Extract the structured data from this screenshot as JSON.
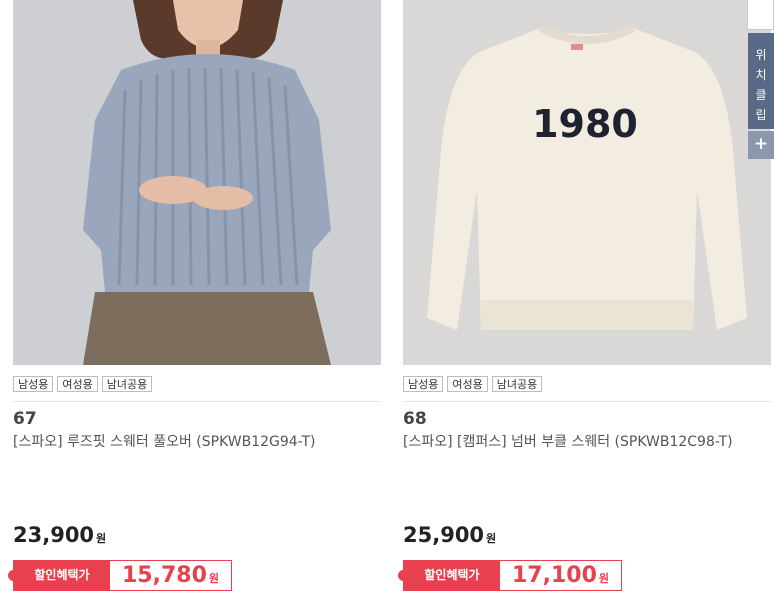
{
  "products": [
    {
      "tags": [
        "남성용",
        "여성용",
        "남녀공용"
      ],
      "rank": "67",
      "name": "[스파오] 루즈핏 스웨터 풀오버 (SPKWB12G94-T)",
      "price": "23,900",
      "price_unit": "원",
      "discount_label": "할인혜택가",
      "discount_price": "15,780",
      "discount_unit": "원"
    },
    {
      "tags": [
        "남성용",
        "여성용",
        "남녀공용"
      ],
      "rank": "68",
      "name": "[스파오] [캠퍼스] 넘버 부클 스웨터 (SPKWB12C98-T)",
      "price": "25,900",
      "price_unit": "원",
      "discount_label": "할인혜택가",
      "discount_price": "17,100",
      "discount_unit": "원",
      "sweater_print": "1980"
    }
  ],
  "side_widget": {
    "clip_label": [
      "위",
      "치",
      "클",
      "립"
    ],
    "plus": "+"
  },
  "colors": {
    "accent": "#e8404f",
    "side_dark": "#586a86",
    "side_light": "#8a97ac"
  }
}
